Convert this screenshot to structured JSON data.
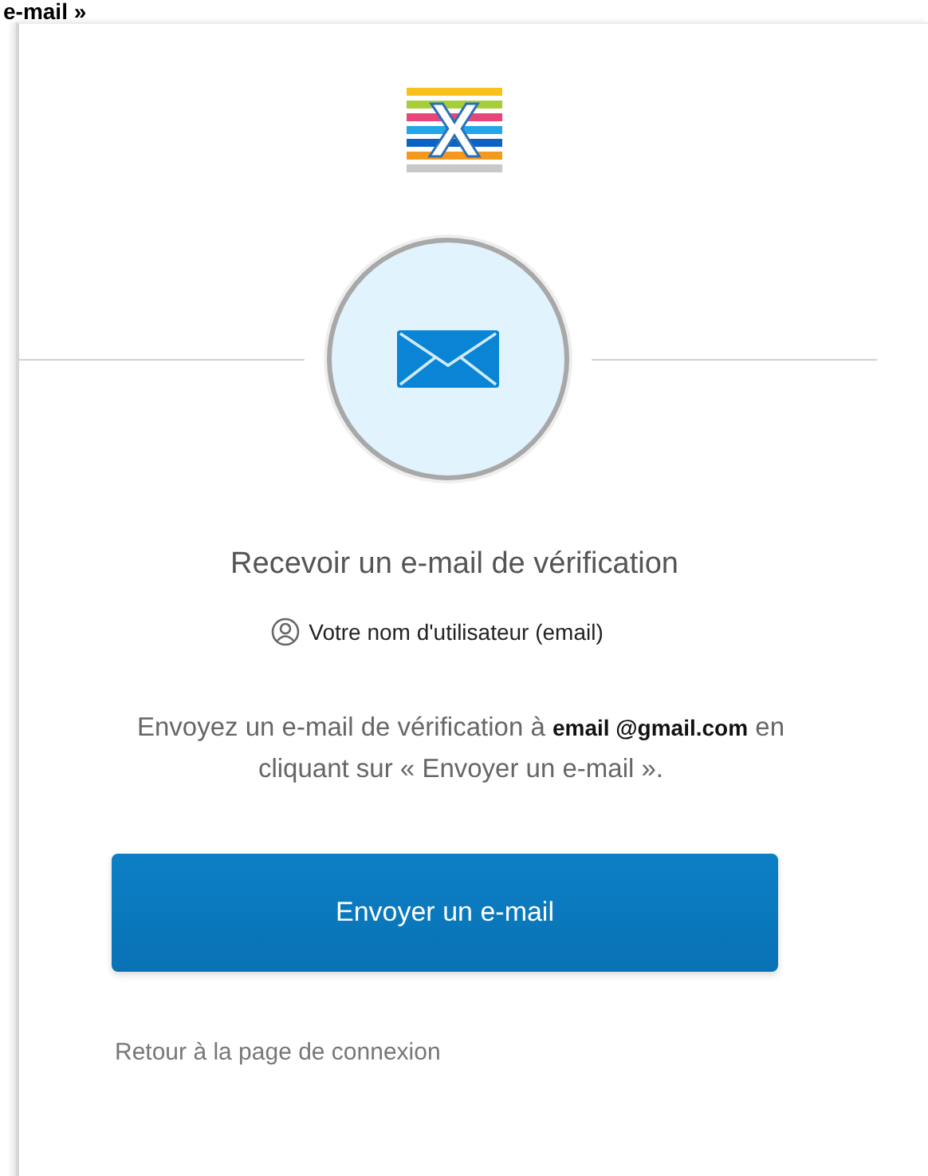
{
  "caption": "e-mail »",
  "logo": {
    "text": "X"
  },
  "title": "Recevoir un e-mail de vérification",
  "username_hint": "Votre nom d'utilisateur (email)",
  "message": "Envoyez un e-mail de vérification à **email @gmail.com** en cliquant sur « Envoyer un e-mail ».",
  "send_button": "Envoyer un e-mail",
  "back_link": "Retour à la page de connexion"
}
